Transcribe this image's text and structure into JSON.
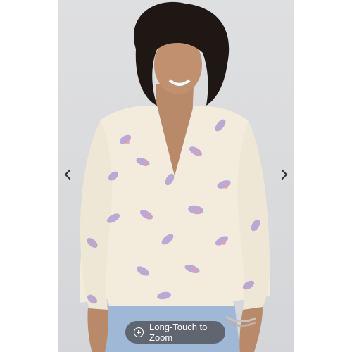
{
  "viewer": {
    "prev_icon": "chevron-left-icon",
    "next_icon": "chevron-right-icon",
    "zoom_hint": "Long-Touch to Zoom",
    "zoom_icon": "plus-circle-icon"
  },
  "colors": {
    "background": "#ffffff",
    "photo_backdrop": "#dcdde0",
    "blouse": "#f3ecdc",
    "paisley_purple": "#9a7cc4",
    "paisley_pink": "#d88a9a",
    "pants": "#9fb8d6",
    "pill_bg": "#464646"
  }
}
